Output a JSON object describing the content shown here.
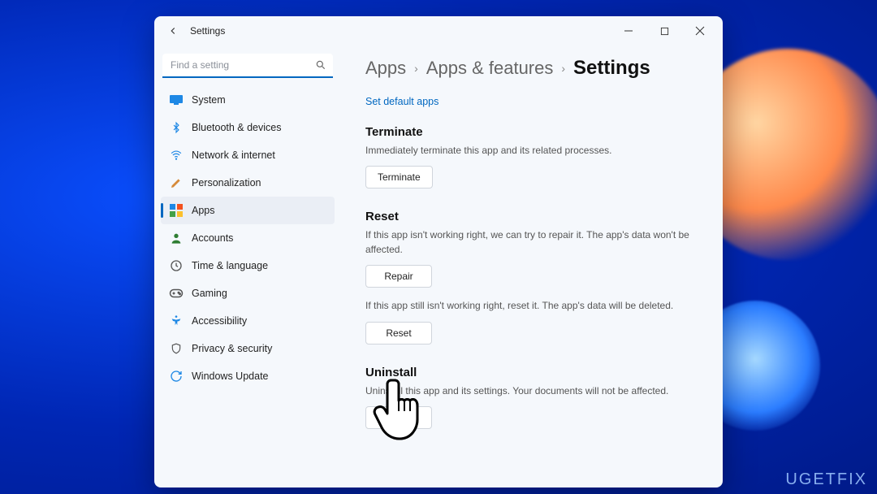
{
  "window": {
    "title": "Settings"
  },
  "search": {
    "placeholder": "Find a setting"
  },
  "sidebar": {
    "items": [
      {
        "label": "System"
      },
      {
        "label": "Bluetooth & devices"
      },
      {
        "label": "Network & internet"
      },
      {
        "label": "Personalization"
      },
      {
        "label": "Apps"
      },
      {
        "label": "Accounts"
      },
      {
        "label": "Time & language"
      },
      {
        "label": "Gaming"
      },
      {
        "label": "Accessibility"
      },
      {
        "label": "Privacy & security"
      },
      {
        "label": "Windows Update"
      }
    ],
    "active_index": 4
  },
  "breadcrumb": {
    "a": "Apps",
    "b": "Apps & features",
    "c": "Settings"
  },
  "link_default_apps": "Set default apps",
  "terminate": {
    "title": "Terminate",
    "desc": "Immediately terminate this app and its related processes.",
    "btn": "Terminate"
  },
  "reset": {
    "title": "Reset",
    "repair_desc": "If this app isn't working right, we can try to repair it. The app's data won't be affected.",
    "repair_btn": "Repair",
    "reset_desc": "If this app still isn't working right, reset it. The app's data will be deleted.",
    "reset_btn": "Reset"
  },
  "uninstall": {
    "title": "Uninstall",
    "desc": "Uninstall this app and its settings. Your documents will not be affected.",
    "btn": "Uninstall"
  },
  "watermark": "UGETFIX"
}
